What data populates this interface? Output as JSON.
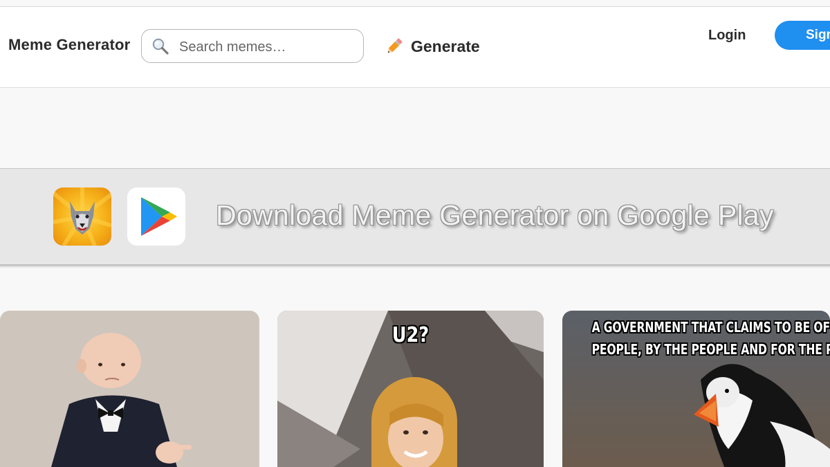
{
  "header": {
    "logo_text": "Meme Generator",
    "search_placeholder": "Search memes…",
    "generate_label": "Generate",
    "login_label": "Login",
    "signup_label": "Sign"
  },
  "banner": {
    "text": "Download Meme Generator on Google Play"
  },
  "memes": [
    {
      "caption_top": ""
    },
    {
      "caption_top": "U2?"
    },
    {
      "caption_line_1": "A GOVERNMENT THAT CLAIMS TO BE OF THE",
      "caption_line_2": "PEOPLE, BY THE PEOPLE AND FOR THE PEOPLE"
    }
  ],
  "colors": {
    "accent": "#1f8ff0",
    "header_bg": "#ffffff",
    "page_bg": "#f8f8f8",
    "banner_bg": "#e7e7e7"
  },
  "icons": {
    "search": "magnifier-icon",
    "generate": "pencil-icon",
    "app": "courage-wolf-icon",
    "store": "google-play-icon"
  }
}
